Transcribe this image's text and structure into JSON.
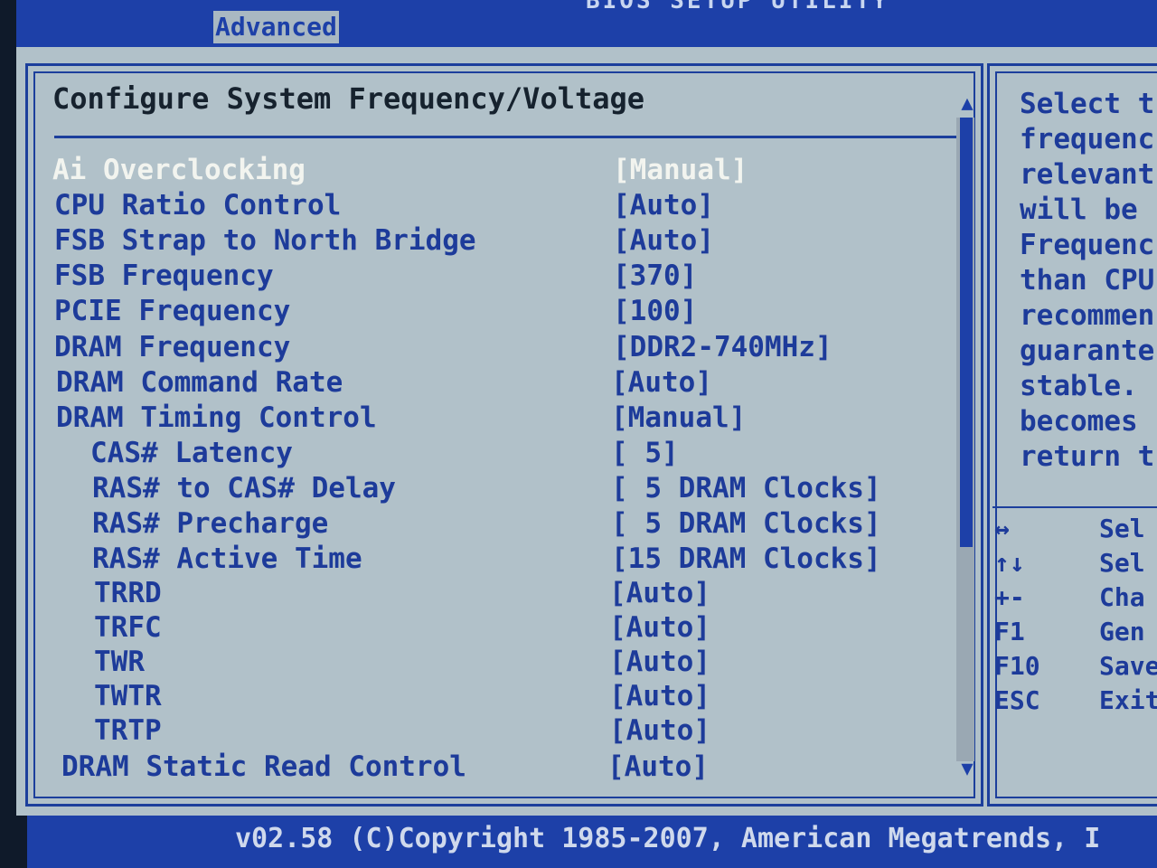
{
  "header": {
    "title": "BIOS SETUP UTILITY",
    "active_tab": "Advanced"
  },
  "section_title": "Configure System Frequency/Voltage",
  "settings": [
    {
      "label": "Ai Overclocking",
      "value": "[Manual]"
    },
    {
      "label": "CPU Ratio Control",
      "value": "[Auto]"
    },
    {
      "label": "FSB Strap to North Bridge",
      "value": "[Auto]"
    },
    {
      "label": "FSB Frequency",
      "value": "[370]"
    },
    {
      "label": "PCIE Frequency",
      "value": "[100]"
    },
    {
      "label": "DRAM Frequency",
      "value": "[DDR2-740MHz]"
    },
    {
      "label": "DRAM Command Rate",
      "value": "[Auto]"
    },
    {
      "label": "DRAM Timing Control",
      "value": "[Manual]"
    },
    {
      "label": "CAS# Latency",
      "value": "[ 5]"
    },
    {
      "label": "RAS# to CAS# Delay",
      "value": "[ 5 DRAM Clocks]"
    },
    {
      "label": "RAS# Precharge",
      "value": "[ 5 DRAM Clocks]"
    },
    {
      "label": "RAS# Active Time",
      "value": "[15 DRAM Clocks]"
    },
    {
      "label": "TRRD",
      "value": "[Auto]"
    },
    {
      "label": "TRFC",
      "value": "[Auto]"
    },
    {
      "label": "TWR",
      "value": "[Auto]"
    },
    {
      "label": "TWTR",
      "value": "[Auto]"
    },
    {
      "label": "TRTP",
      "value": "[Auto]"
    },
    {
      "label": "DRAM Static Read Control",
      "value": "[Auto]"
    }
  ],
  "help_lines": [
    "Select t",
    "frequenc",
    "relevant",
    "will be",
    "Frequenc",
    "than CPU",
    "recommen",
    "guarante",
    "stable.",
    "becomes",
    "return t"
  ],
  "keys": [
    {
      "key": "↔",
      "desc": "Sel"
    },
    {
      "key": "↑↓",
      "desc": "Sel"
    },
    {
      "key": "+-",
      "desc": "Cha"
    },
    {
      "key": "F1",
      "desc": "Gen"
    },
    {
      "key": "F10",
      "desc": "Save"
    },
    {
      "key": "ESC",
      "desc": "Exit"
    }
  ],
  "footer": "v02.58 (C)Copyright 1985-2007, American Megatrends, I"
}
